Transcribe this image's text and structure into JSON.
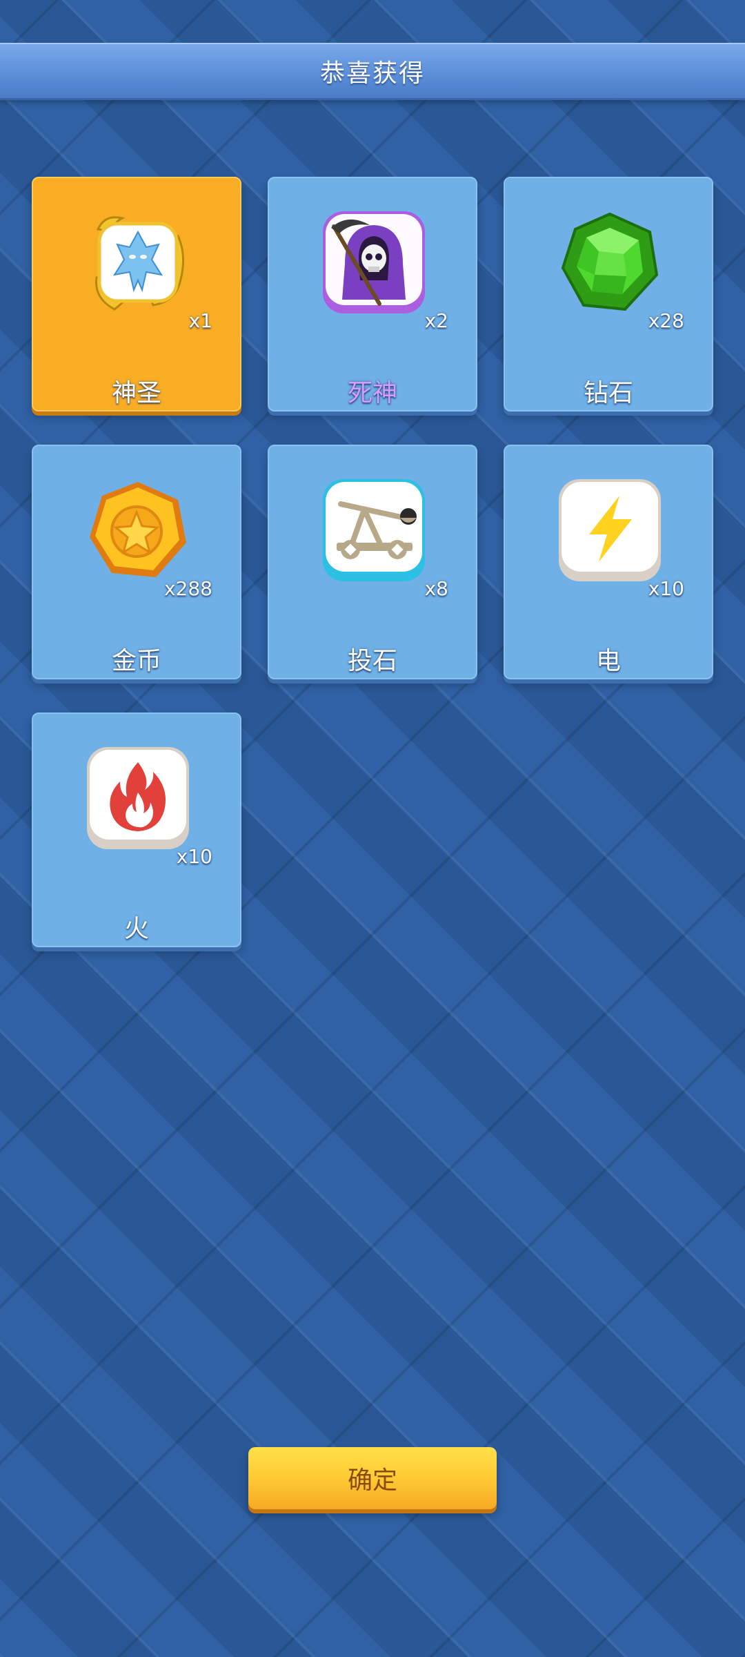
{
  "header": {
    "title": "恭喜获得"
  },
  "rewards": [
    {
      "name": "神圣",
      "quantity": "x1",
      "icon": "holy-dragon-icon"
    },
    {
      "name": "死神",
      "quantity": "x2",
      "icon": "grim-reaper-icon"
    },
    {
      "name": "钻石",
      "quantity": "x28",
      "icon": "diamond-icon"
    },
    {
      "name": "金币",
      "quantity": "x288",
      "icon": "gold-coin-icon"
    },
    {
      "name": "投石",
      "quantity": "x8",
      "icon": "catapult-icon"
    },
    {
      "name": "电",
      "quantity": "x10",
      "icon": "lightning-icon"
    },
    {
      "name": "火",
      "quantity": "x10",
      "icon": "fire-icon"
    }
  ],
  "footer": {
    "confirm_label": "确定"
  },
  "colors": {
    "background": "#2a5898",
    "card": "#6fb0e6",
    "card_highlight": "#f8ad25",
    "button": "#ffcd35",
    "reaper_name": "#d79cff"
  }
}
